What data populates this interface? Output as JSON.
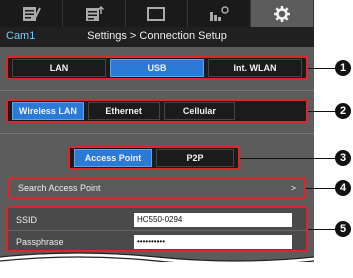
{
  "toolbar": {
    "icons": [
      "list-edit-icon",
      "list-export-icon",
      "monitor-icon",
      "camera-settings-icon",
      "gear-icon"
    ],
    "active_index": 4
  },
  "header": {
    "camera_name": "Cam1",
    "title": "Settings > Connection Setup"
  },
  "interface_tabs": {
    "items": [
      "LAN",
      "USB",
      "Int. WLAN"
    ],
    "selected": "USB"
  },
  "connection_types": {
    "items": [
      "Wireless LAN",
      "Ethernet",
      "Cellular"
    ],
    "selected": "Wireless LAN"
  },
  "wlan_modes": {
    "items": [
      "Access Point",
      "P2P"
    ],
    "selected": "Access Point"
  },
  "search_row": {
    "label": "Search Access Point",
    "chevron": ">"
  },
  "form": {
    "ssid_label": "SSID",
    "ssid_value": "HC550-0294",
    "passphrase_label": "Passphrase",
    "passphrase_value": "••••••••••"
  },
  "callouts": [
    "1",
    "2",
    "3",
    "4",
    "5"
  ],
  "colors": {
    "highlight": "#e0242e",
    "selected_blue": "#2a7ad6",
    "camera_name": "#79c9ff"
  }
}
